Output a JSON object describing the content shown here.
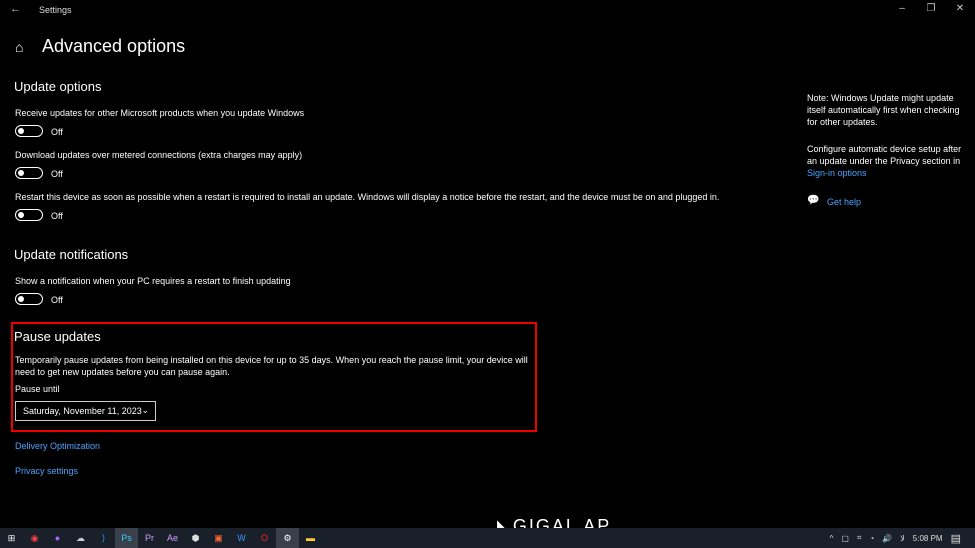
{
  "window": {
    "title": "Settings",
    "back": "←",
    "min": "–",
    "restore": "❐",
    "close": "✕"
  },
  "page": {
    "title": "Advanced options",
    "home_icon": "home-icon"
  },
  "update_options": {
    "heading": "Update options",
    "items": [
      {
        "label": "Receive updates for other Microsoft products when you update Windows",
        "state": "Off"
      },
      {
        "label": "Download updates over metered connections (extra charges may apply)",
        "state": "Off"
      },
      {
        "label": "Restart this device as soon as possible when a restart is required to install an update. Windows will display a notice before the restart, and the device must be on and plugged in.",
        "state": "Off"
      }
    ]
  },
  "update_notifications": {
    "heading": "Update notifications",
    "items": [
      {
        "label": "Show a notification when your PC requires a restart to finish updating",
        "state": "Off"
      }
    ]
  },
  "pause": {
    "heading": "Pause updates",
    "description": "Temporarily pause updates from being installed on this device for up to 35 days. When you reach the pause limit, your device will need to get new updates before you can pause again.",
    "pause_until_label": "Pause until",
    "selected": "Saturday, November 11, 2023",
    "highlight_color": "#e00000"
  },
  "links": {
    "delivery": "Delivery Optimization",
    "privacy": "Privacy settings"
  },
  "side": {
    "note": "Note: Windows Update might update itself automatically first when checking for other updates.",
    "config": "Configure automatic device setup after an update under the Privacy section in",
    "signin": "Sign-in options",
    "help": "Get help"
  },
  "taskbar": {
    "icons": [
      "windows-start",
      "record",
      "github",
      "cloud",
      "vscode",
      "photoshop",
      "premiere",
      "after-effects",
      "settings-gear",
      "app",
      "word",
      "opera",
      "settings",
      "file-explorer"
    ],
    "time": "5:08 PM"
  },
  "watermark": "GIGALAP"
}
